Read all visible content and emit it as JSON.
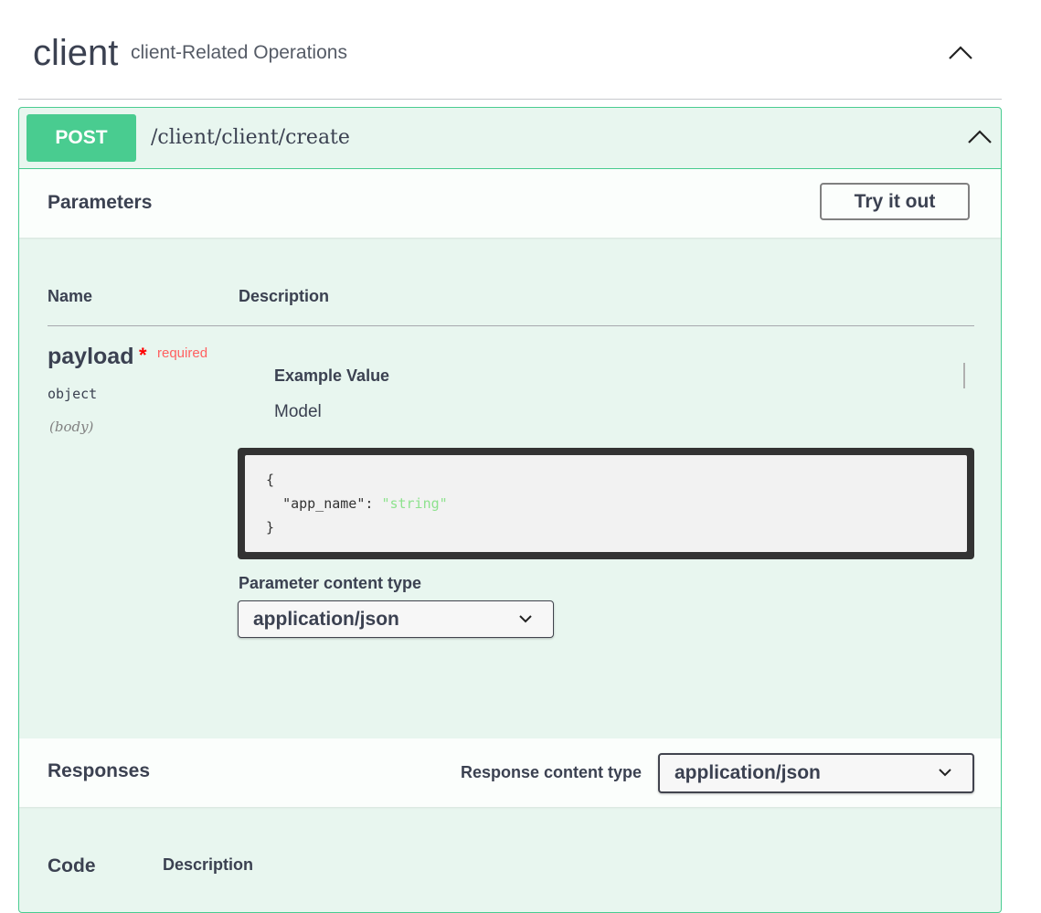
{
  "tag": {
    "name": "client",
    "description": "client-Related Operations"
  },
  "operation": {
    "method": "POST",
    "path": "/client/client/create",
    "method_color": "#49cc90"
  },
  "parameters": {
    "title": "Parameters",
    "try_button": "Try it out",
    "columns": {
      "name": "Name",
      "description": "Description"
    },
    "param": {
      "name": "payload",
      "required_star": "*",
      "required_label": "required",
      "type": "object",
      "in": "(body)"
    },
    "example_tab": "Example Value",
    "model_tab": "Model",
    "example": {
      "open": "{",
      "key": "\"app_name\"",
      "colon": ": ",
      "value": "\"string\"",
      "close": "}"
    },
    "content_type_label": "Parameter content type",
    "content_type_value": "application/json"
  },
  "responses": {
    "title": "Responses",
    "content_type_label": "Response content type",
    "content_type_value": "application/json",
    "columns": {
      "code": "Code",
      "description": "Description"
    }
  },
  "icons": {
    "tag_toggle": "chevron-up-icon",
    "op_toggle": "chevron-up-icon",
    "select_arrow": "chevron-down-icon"
  }
}
